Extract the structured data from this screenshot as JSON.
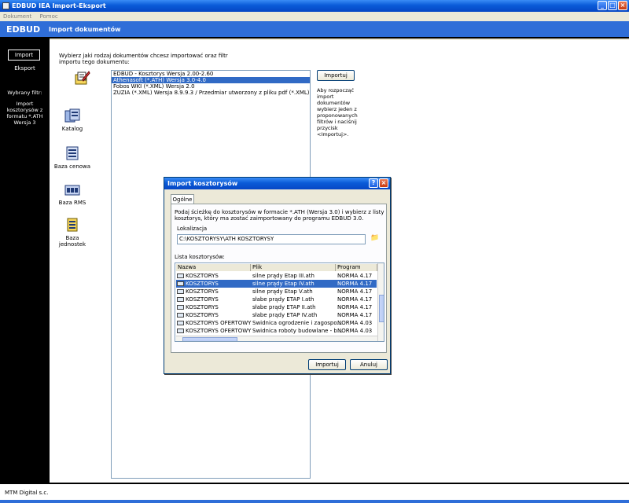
{
  "app_title": "EDBUD IEA Import-Eksport",
  "menu": [
    "Dokument",
    "Pomoc"
  ],
  "brand": "EDBUD",
  "section_heading": "Import dokumentów",
  "sidebar": {
    "import_label": "Import",
    "export_label": "Eksport",
    "filter_label": "Wybrany filtr:",
    "filter_value": "Import kosztorysów z formatu *.ATH Wersja 3"
  },
  "company": "MTM Digital s.c.",
  "main": {
    "instruction": "Wybierz jaki rodzaj dokumentów chcesz importować oraz filtr importu tego dokumentu:",
    "document_types": [
      "Kosztorys",
      "Katalog",
      "Baza cenowa",
      "Baza RMS",
      "Baza jednostek"
    ],
    "filters": [
      "EDBUD - Kosztorys Wersja 2.00-2.60",
      "Athenasoft (*.ATH) Wersja 3.0-4.0",
      "Fobos WKI (*.XML) Wersja 2.0",
      "ZUZIA (*.XML) Wersja 8.9.9.3 / Przedmiar utworzony z pliku pdf (*.XML)"
    ],
    "import_button": "Importuj",
    "hint": "Aby rozpocząć import dokumentów wybierz jeden z proponowanych filtrów i naciśnij przycisk <Importuj>."
  },
  "dialog": {
    "title": "Import kosztorysów",
    "tab": "Ogólne",
    "description": "Podaj ścieżkę do kosztorysów w formacie *.ATH (Wersja 3.0) i wybierz z listy kosztorys, który ma zostać zaimportowany do programu EDBUD 3.0.",
    "location_label": "Lokalizacja",
    "location_value": "C:\\KOSZTORYSY\\ATH KOSZTORYSY",
    "list_label": "Lista kosztorysów:",
    "columns": [
      "Nazwa",
      "Plik",
      "Program"
    ],
    "rows": [
      {
        "name": "KOSZTORYS",
        "file": "silne prądy Etap III.ath",
        "program": "NORMA 4.17"
      },
      {
        "name": "KOSZTORYS",
        "file": "silne prądy Etap IV.ath",
        "program": "NORMA 4.17"
      },
      {
        "name": "KOSZTORYS",
        "file": "silne prądy Etap V.ath",
        "program": "NORMA 4.17"
      },
      {
        "name": "KOSZTORYS",
        "file": "słabe prądy ETAP I.ath",
        "program": "NORMA 4.17"
      },
      {
        "name": "KOSZTORYS",
        "file": "słabe prądy ETAP II.ath",
        "program": "NORMA 4.17"
      },
      {
        "name": "KOSZTORYS",
        "file": "słabe prądy ETAP IV.ath",
        "program": "NORMA 4.17"
      },
      {
        "name": "KOSZTORYS OFERTOWY",
        "file": "Swidnica ogrodzenie i zagospo...",
        "program": "NORMA 4.03"
      },
      {
        "name": "KOSZTORYS OFERTOWY",
        "file": "Swidnica roboty budowlane - b...",
        "program": "NORMA 4.03"
      }
    ],
    "import_button": "Importuj",
    "cancel_button": "Anuluj"
  }
}
